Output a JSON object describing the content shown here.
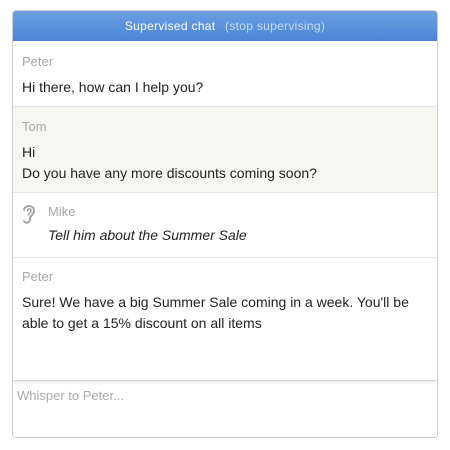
{
  "header": {
    "title": "Supervised chat",
    "stop_link": "(stop supervising)"
  },
  "messages": [
    {
      "sender": "Peter",
      "text": "Hi there, how can I help you?"
    },
    {
      "sender": "Tom",
      "text": "Hi\nDo you have any more discounts coming soon?"
    },
    {
      "sender": "Mike",
      "text": "Tell him about the Summer Sale",
      "icon": "ear-icon"
    },
    {
      "sender": "Peter",
      "text": "Sure! We have a big Summer Sale coming in a week. You'll be able to get a 15% discount on all items"
    }
  ],
  "input": {
    "placeholder": "Whisper to Peter...",
    "value": ""
  },
  "colors": {
    "header_bg": "#4a86d8",
    "customer_row_bg": "#f7f7f2",
    "sender_text": "#a6a6a6"
  }
}
